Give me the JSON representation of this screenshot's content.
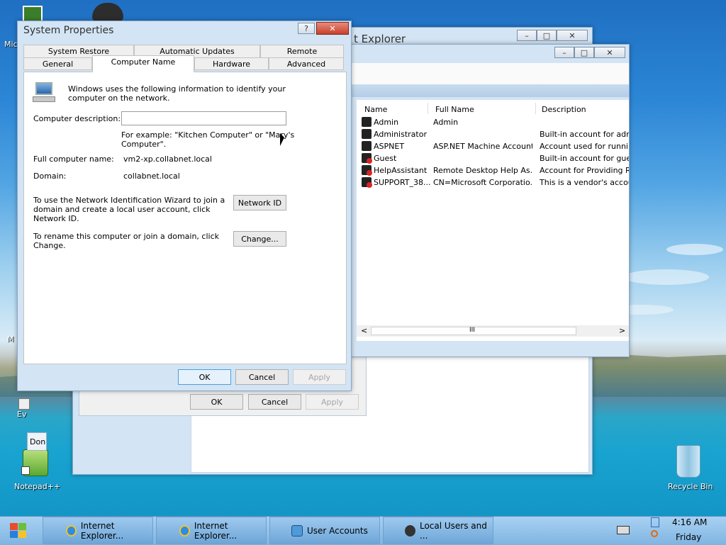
{
  "desktop": {
    "icons": [
      {
        "label": "Mic"
      },
      {
        "label": "M"
      },
      {
        "label": "Ev"
      },
      {
        "label": "Notepad++"
      },
      {
        "label": "Recycle Bin"
      }
    ]
  },
  "back_window": {
    "title": "t Explorer",
    "ok": "OK",
    "cancel": "Cancel",
    "apply": "Apply",
    "fragment": "Don"
  },
  "users_window": {
    "columns": [
      "Name",
      "Full Name",
      "Description"
    ],
    "rows": [
      {
        "name": "Admin",
        "full_name": "Admin",
        "description": ""
      },
      {
        "name": "Administrator",
        "full_name": "",
        "description": "Built-in account for admir"
      },
      {
        "name": "ASPNET",
        "full_name": "ASP.NET Machine Account",
        "description": "Account used for running"
      },
      {
        "name": "Guest",
        "full_name": "",
        "description": "Built-in account for guest"
      },
      {
        "name": "HelpAssistant",
        "full_name": "Remote Desktop Help As...",
        "description": "Account for Providing Re"
      },
      {
        "name": "SUPPORT_38...",
        "full_name": "CN=Microsoft Corporatio...",
        "description": "This is a vendor's account"
      }
    ],
    "scroll": {
      "left": "<",
      "right": ">",
      "thumb": "III"
    }
  },
  "dialog": {
    "title": "System Properties",
    "help": "?",
    "tabs_row1": [
      "System Restore",
      "Automatic Updates",
      "Remote"
    ],
    "tabs_row2": [
      "General",
      "Computer Name",
      "Hardware",
      "Advanced"
    ],
    "intro": [
      "Windows uses the following information to identify your",
      "computer on the network."
    ],
    "description_label": "Computer description:",
    "description_value": "",
    "example": [
      "For example: \"Kitchen Computer\" or \"Mary's",
      "Computer\"."
    ],
    "full_name_label": "Full computer name:",
    "full_name_value": "vm2-xp.collabnet.local",
    "domain_label": "Domain:",
    "domain_value": "collabnet.local",
    "wizard_text": [
      "To use the Network Identification Wizard to join a",
      "domain and create a local user account, click",
      "Network ID."
    ],
    "network_id_button": "Network ID",
    "rename_text": [
      "To rename this computer or join a domain, click",
      "Change."
    ],
    "change_button": "Change...",
    "ok": "OK",
    "cancel": "Cancel",
    "apply": "Apply"
  },
  "taskbar": {
    "items": [
      {
        "label": "Internet Explorer..."
      },
      {
        "label": "Internet Explorer..."
      },
      {
        "label": "User Accounts"
      },
      {
        "label": "Local Users and ..."
      }
    ],
    "time": "4:16 AM",
    "day": "Friday"
  }
}
